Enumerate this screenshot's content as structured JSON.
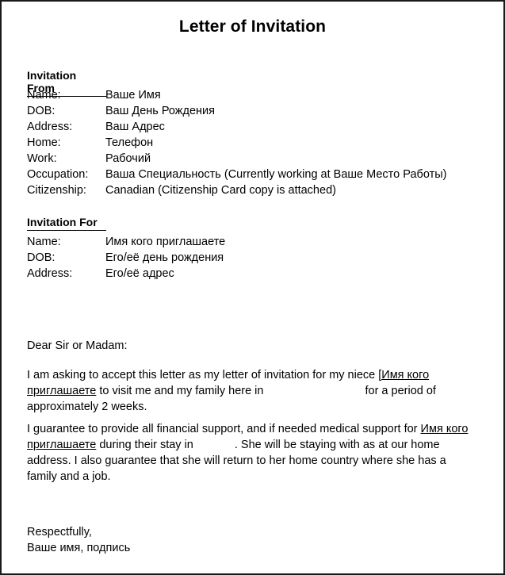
{
  "document": {
    "title": "Letter of Invitation",
    "sections": [
      {
        "heading": "Invitation From",
        "fields": [
          {
            "label": "Name:",
            "value": "Ваше Имя"
          },
          {
            "label": "DOB:",
            "value": "Ваш День Рождения"
          },
          {
            "label": "Address:",
            "value": "Ваш Адрес"
          },
          {
            "label": "Home:",
            "value": "Телефон"
          },
          {
            "label": "Work:",
            "value": "Рабочий"
          },
          {
            "label": "Occupation:",
            "value": "Ваша Специальность (Currently working at Ваше Место Работы)"
          },
          {
            "label": "Citizenship:",
            "value": "Canadian (Citizenship Card copy is attached)"
          }
        ]
      },
      {
        "heading": "Invitation For",
        "fields": [
          {
            "label": "Name:",
            "value": "Имя кого приглашаете"
          },
          {
            "label": "DOB:",
            "value": "Его/её день рождения"
          },
          {
            "label": "Address:",
            "value": "Его/её адрес"
          }
        ]
      }
    ],
    "salutation": "Dear Sir or Madam:",
    "paragraph_1": {
      "part_1": "I am asking to accept this letter as my letter of invitation for my niece ",
      "underlined_1": "[Имя кого приглашаете",
      "part_2": " to visit me and my family here in",
      "blank_1": "",
      "part_3": "for a period of approximately 2 weeks."
    },
    "paragraph_2": {
      "part_1": "I guarantee to provide all financial support, and if needed medical support for ",
      "underlined_1": "Имя кого приглашаете",
      "part_2": " during their stay in",
      "blank_1": "",
      "part_3": ". She will be staying with as at our home address. I also guarantee that she will return to her home country where she has a family and a job."
    },
    "closing": {
      "line_1": "Respectfully,",
      "line_2": "Ваше имя, подпись"
    },
    "colors": {
      "text": "#000000",
      "border": "#1a1a1a",
      "background": "#ffffff"
    }
  }
}
